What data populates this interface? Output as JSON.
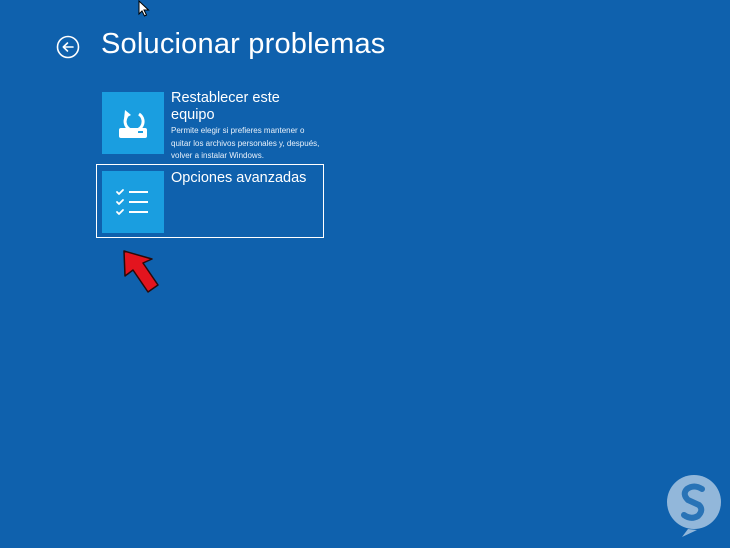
{
  "header": {
    "title": "Solucionar problemas",
    "back_icon": "arrow-left-circle-icon"
  },
  "tiles": [
    {
      "title": "Restablecer este equipo",
      "description": "Permite elegir si prefieres mantener o quitar los archivos personales y, después, volver a instalar Windows.",
      "icon": "reset-pc-icon",
      "selected": false
    },
    {
      "title": "Opciones avanzadas",
      "description": "",
      "icon": "checklist-icon",
      "selected": true
    }
  ],
  "colors": {
    "background": "#0f61ad",
    "tile_icon_bg": "#1a9ee0",
    "annotation_arrow": "#e3141e"
  },
  "overlays": {
    "pointer": "mouse-cursor-icon",
    "annotation": "red-arrow-icon",
    "watermark": "solvetic-logo-icon"
  }
}
